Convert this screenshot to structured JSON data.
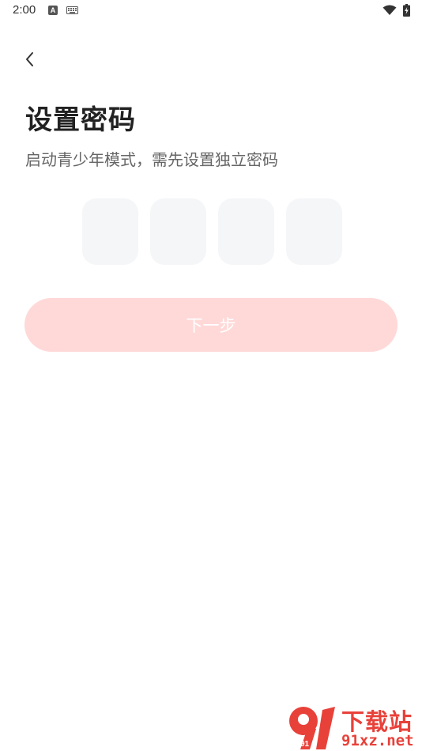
{
  "status_bar": {
    "time": "2:00",
    "notification_icon_letter": "A",
    "icons": [
      "text-notification-icon",
      "keyboard-icon",
      "wifi-icon",
      "battery-charging-icon"
    ]
  },
  "header": {
    "back_icon": "chevron-left-icon"
  },
  "main": {
    "title": "设置密码",
    "subtitle": "启动青少年模式，需先设置独立密码",
    "pin_boxes": [
      "",
      "",
      "",
      ""
    ],
    "next_button_label": "下一步"
  },
  "watermark": {
    "logo_text": "91",
    "title": "下载站",
    "url": "91xz.net"
  },
  "colors": {
    "background": "#ffffff",
    "title": "#222222",
    "subtitle": "#666666",
    "pin_box": "#f5f6f8",
    "button_disabled": "#ffd9d8",
    "button_text": "#ffffff",
    "watermark": "#e8413a"
  }
}
